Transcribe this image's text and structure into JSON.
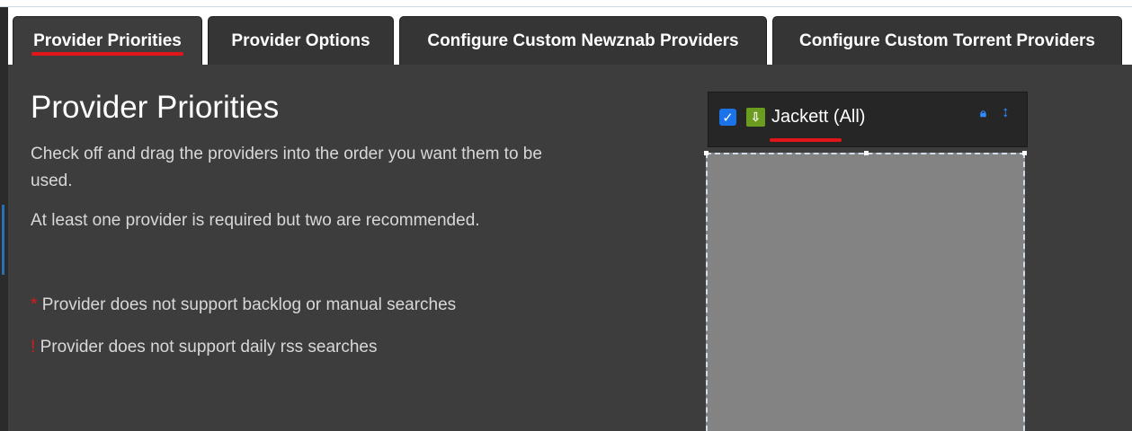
{
  "tabs": [
    {
      "label": "Provider Priorities",
      "active": true
    },
    {
      "label": "Provider Options",
      "active": false
    },
    {
      "label": "Configure Custom Newznab Providers",
      "active": false
    },
    {
      "label": "Configure Custom Torrent Providers",
      "active": false
    }
  ],
  "main": {
    "title": "Provider Priorities",
    "description": "Check off and drag the providers into the order you want them to be used.",
    "note": "At least one provider is required but two are recommended.",
    "legend": [
      {
        "symbol": "*",
        "text": "Provider does not support backlog or manual searches"
      },
      {
        "symbol": "!",
        "text": "Provider does not support daily rss searches"
      }
    ]
  },
  "providers": [
    {
      "name": "Jackett (All)",
      "checked": true,
      "icon": "jackett-icon"
    }
  ],
  "icons": {
    "checkbox": "checkbox-icon",
    "lock": "lock-icon",
    "move": "move-updown-icon"
  },
  "colors": {
    "accent_blue": "#1a73e8",
    "annotation_red": "#e0161b",
    "panel_bg": "#3d3d3d"
  }
}
